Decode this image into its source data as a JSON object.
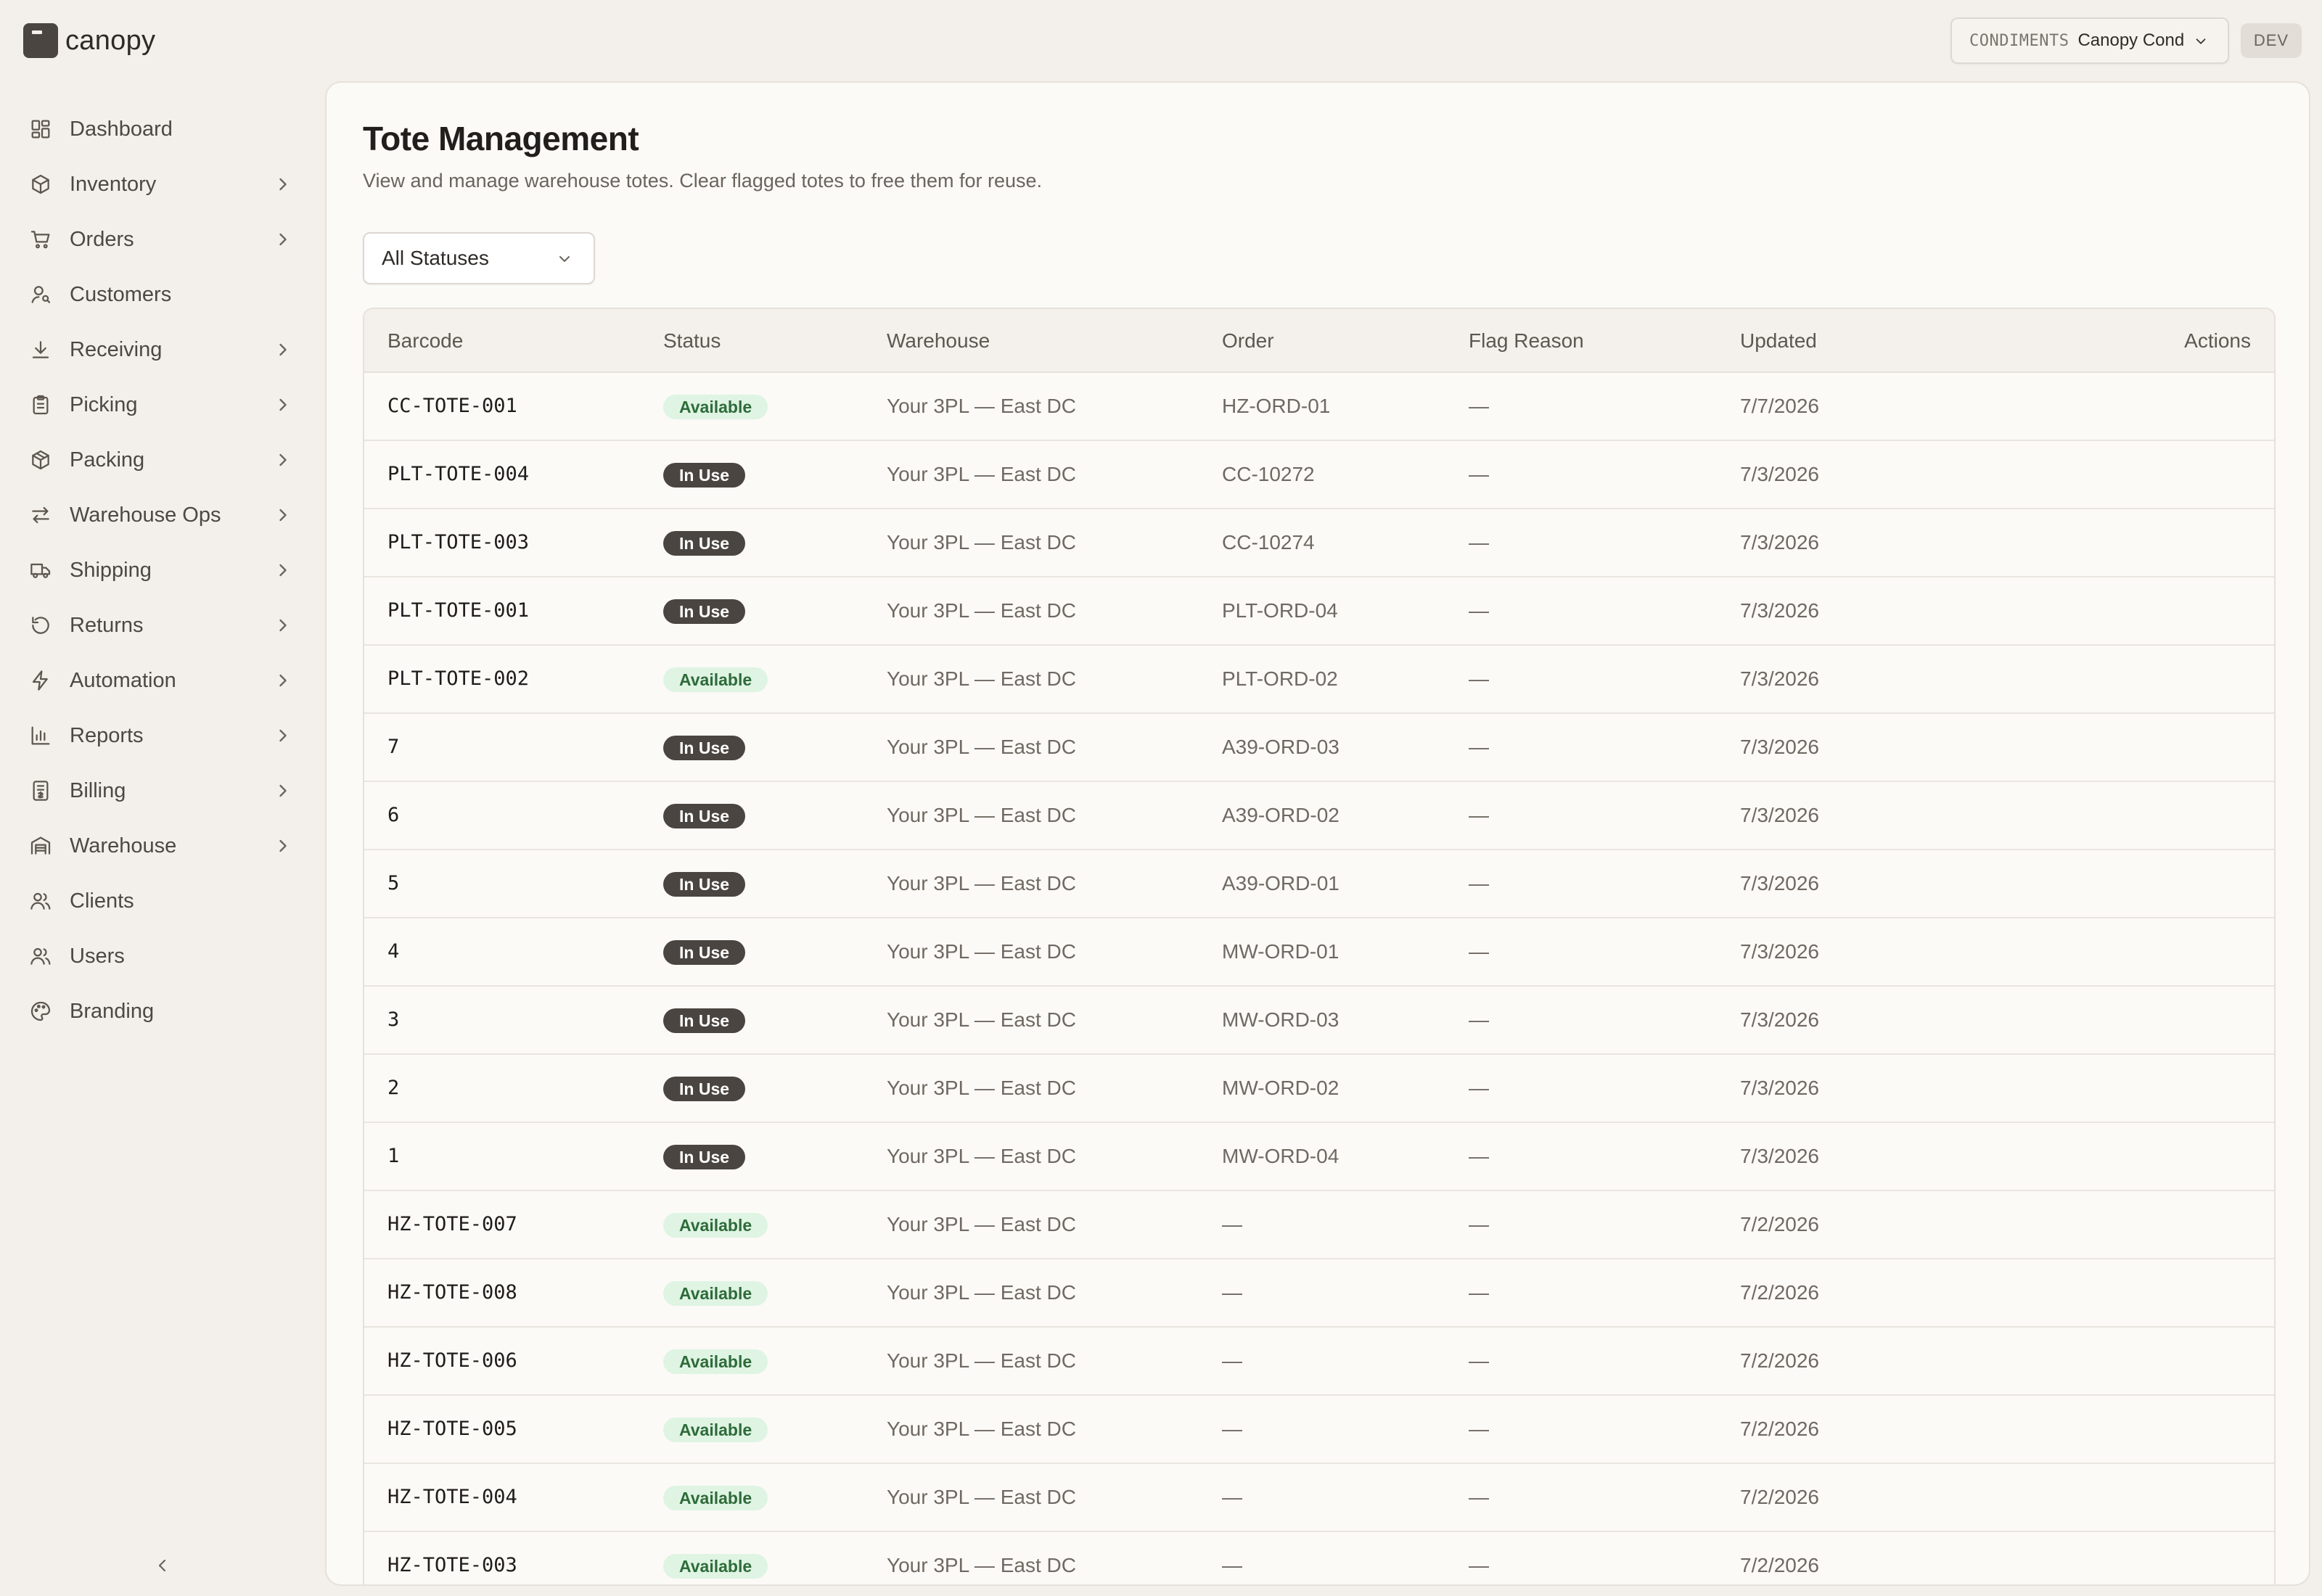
{
  "brand": {
    "name": "canopy"
  },
  "nav": [
    {
      "label": "Dashboard",
      "icon": "dashboard-icon",
      "has_children": false
    },
    {
      "label": "Inventory",
      "icon": "box-icon",
      "has_children": true
    },
    {
      "label": "Orders",
      "icon": "cart-icon",
      "has_children": true
    },
    {
      "label": "Customers",
      "icon": "user-search-icon",
      "has_children": false
    },
    {
      "label": "Receiving",
      "icon": "download-icon",
      "has_children": true
    },
    {
      "label": "Picking",
      "icon": "clipboard-icon",
      "has_children": true
    },
    {
      "label": "Packing",
      "icon": "package-icon",
      "has_children": true
    },
    {
      "label": "Warehouse Ops",
      "icon": "arrows-icon",
      "has_children": true
    },
    {
      "label": "Shipping",
      "icon": "truck-icon",
      "has_children": true
    },
    {
      "label": "Returns",
      "icon": "rotate-icon",
      "has_children": true
    },
    {
      "label": "Automation",
      "icon": "lightning-icon",
      "has_children": true
    },
    {
      "label": "Reports",
      "icon": "bar-chart-icon",
      "has_children": true
    },
    {
      "label": "Billing",
      "icon": "receipt-icon",
      "has_children": true
    },
    {
      "label": "Warehouse",
      "icon": "warehouse-icon",
      "has_children": true
    },
    {
      "label": "Clients",
      "icon": "users-icon",
      "has_children": false
    },
    {
      "label": "Users",
      "icon": "users-icon",
      "has_children": false
    },
    {
      "label": "Branding",
      "icon": "palette-icon",
      "has_children": false
    }
  ],
  "org_switcher": {
    "label": "CONDIMENTS",
    "name": "Canopy Cond"
  },
  "env_badge": "DEV",
  "page": {
    "title": "Tote Management",
    "subtitle": "View and manage warehouse totes. Clear flagged totes to free them for reuse."
  },
  "filter": {
    "selected": "All Statuses"
  },
  "table": {
    "columns": [
      "Barcode",
      "Status",
      "Warehouse",
      "Order",
      "Flag Reason",
      "Updated",
      "Actions"
    ],
    "rows": [
      {
        "barcode": "CC-TOTE-001",
        "status": "Available",
        "warehouse": "Your 3PL — East DC",
        "order": "HZ-ORD-01",
        "flag": "—",
        "updated": "7/7/2026"
      },
      {
        "barcode": "PLT-TOTE-004",
        "status": "In Use",
        "warehouse": "Your 3PL — East DC",
        "order": "CC-10272",
        "flag": "—",
        "updated": "7/3/2026"
      },
      {
        "barcode": "PLT-TOTE-003",
        "status": "In Use",
        "warehouse": "Your 3PL — East DC",
        "order": "CC-10274",
        "flag": "—",
        "updated": "7/3/2026"
      },
      {
        "barcode": "PLT-TOTE-001",
        "status": "In Use",
        "warehouse": "Your 3PL — East DC",
        "order": "PLT-ORD-04",
        "flag": "—",
        "updated": "7/3/2026"
      },
      {
        "barcode": "PLT-TOTE-002",
        "status": "Available",
        "warehouse": "Your 3PL — East DC",
        "order": "PLT-ORD-02",
        "flag": "—",
        "updated": "7/3/2026"
      },
      {
        "barcode": "7",
        "status": "In Use",
        "warehouse": "Your 3PL — East DC",
        "order": "A39-ORD-03",
        "flag": "—",
        "updated": "7/3/2026"
      },
      {
        "barcode": "6",
        "status": "In Use",
        "warehouse": "Your 3PL — East DC",
        "order": "A39-ORD-02",
        "flag": "—",
        "updated": "7/3/2026"
      },
      {
        "barcode": "5",
        "status": "In Use",
        "warehouse": "Your 3PL — East DC",
        "order": "A39-ORD-01",
        "flag": "—",
        "updated": "7/3/2026"
      },
      {
        "barcode": "4",
        "status": "In Use",
        "warehouse": "Your 3PL — East DC",
        "order": "MW-ORD-01",
        "flag": "—",
        "updated": "7/3/2026"
      },
      {
        "barcode": "3",
        "status": "In Use",
        "warehouse": "Your 3PL — East DC",
        "order": "MW-ORD-03",
        "flag": "—",
        "updated": "7/3/2026"
      },
      {
        "barcode": "2",
        "status": "In Use",
        "warehouse": "Your 3PL — East DC",
        "order": "MW-ORD-02",
        "flag": "—",
        "updated": "7/3/2026"
      },
      {
        "barcode": "1",
        "status": "In Use",
        "warehouse": "Your 3PL — East DC",
        "order": "MW-ORD-04",
        "flag": "—",
        "updated": "7/3/2026"
      },
      {
        "barcode": "HZ-TOTE-007",
        "status": "Available",
        "warehouse": "Your 3PL — East DC",
        "order": "—",
        "flag": "—",
        "updated": "7/2/2026"
      },
      {
        "barcode": "HZ-TOTE-008",
        "status": "Available",
        "warehouse": "Your 3PL — East DC",
        "order": "—",
        "flag": "—",
        "updated": "7/2/2026"
      },
      {
        "barcode": "HZ-TOTE-006",
        "status": "Available",
        "warehouse": "Your 3PL — East DC",
        "order": "—",
        "flag": "—",
        "updated": "7/2/2026"
      },
      {
        "barcode": "HZ-TOTE-005",
        "status": "Available",
        "warehouse": "Your 3PL — East DC",
        "order": "—",
        "flag": "—",
        "updated": "7/2/2026"
      },
      {
        "barcode": "HZ-TOTE-004",
        "status": "Available",
        "warehouse": "Your 3PL — East DC",
        "order": "—",
        "flag": "—",
        "updated": "7/2/2026"
      },
      {
        "barcode": "HZ-TOTE-003",
        "status": "Available",
        "warehouse": "Your 3PL — East DC",
        "order": "—",
        "flag": "—",
        "updated": "7/2/2026"
      }
    ]
  },
  "colors": {
    "available_bg": "#dff4e3",
    "available_fg": "#2e6b3a",
    "inuse_bg": "#4a4540",
    "inuse_fg": "#ffffff"
  }
}
